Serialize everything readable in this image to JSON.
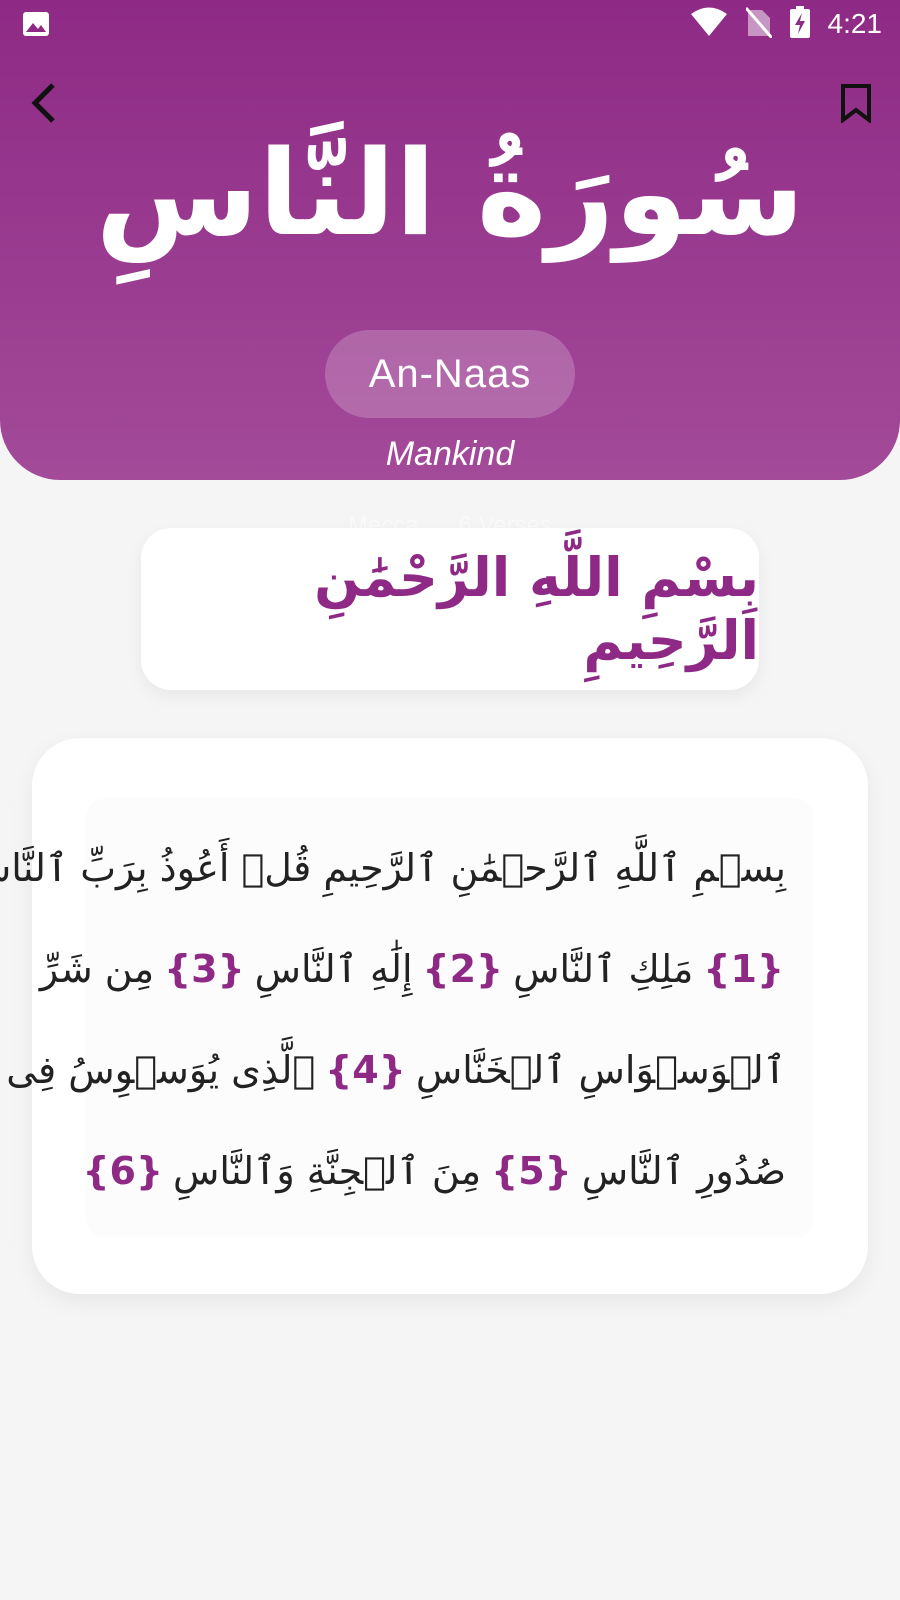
{
  "status_bar": {
    "time": "4:21",
    "icons": [
      "image-icon",
      "wifi-icon",
      "no-sim-icon",
      "battery-charging-icon"
    ]
  },
  "header": {
    "surah_arabic": "سُورَةُ النَّاسِ",
    "surah_name": "An-Naas",
    "surah_meaning": "Mankind",
    "ghost_meta": [
      "Mecca",
      "6 Verses"
    ]
  },
  "bismillah": "بِسْمِ اللَّهِ الرَّحْمَٰنِ الرَّحِيمِ",
  "ayat": {
    "lines": [
      [
        {
          "type": "text",
          "value": "بِسۡمِ ٱللَّهِ ٱلرَّحۡمَٰنِ ٱلرَّحِيمِ قُلۡ أَعُوذُ بِرَبِّ ٱلنَّاسِ"
        }
      ],
      [
        {
          "type": "marker",
          "value": "{1}"
        },
        {
          "type": "text",
          "value": "مَلِكِ ٱلنَّاسِ"
        },
        {
          "type": "marker",
          "value": "{2}"
        },
        {
          "type": "text",
          "value": "إِلَٰهِ ٱلنَّاسِ"
        },
        {
          "type": "marker",
          "value": "{3}"
        },
        {
          "type": "text",
          "value": "مِن شَرِّ"
        }
      ],
      [
        {
          "type": "text",
          "value": "ٱلۡوَسۡوَاسِ ٱلۡخَنَّاسِ"
        },
        {
          "type": "marker",
          "value": "{4}"
        },
        {
          "type": "text",
          "value": "ٱلَّذِى يُوَسۡوِسُ فِى"
        }
      ],
      [
        {
          "type": "text",
          "value": "صُدُورِ ٱلنَّاسِ"
        },
        {
          "type": "marker",
          "value": "{5}"
        },
        {
          "type": "text",
          "value": "مِنَ ٱلۡجِنَّةِ وَٱلنَّاسِ"
        },
        {
          "type": "marker",
          "value": "{6}"
        }
      ]
    ]
  },
  "colors": {
    "accent": "#8e2a85",
    "header_top": "#8e2a85",
    "header_bottom": "#a34a99",
    "background": "#f5f5f5"
  }
}
